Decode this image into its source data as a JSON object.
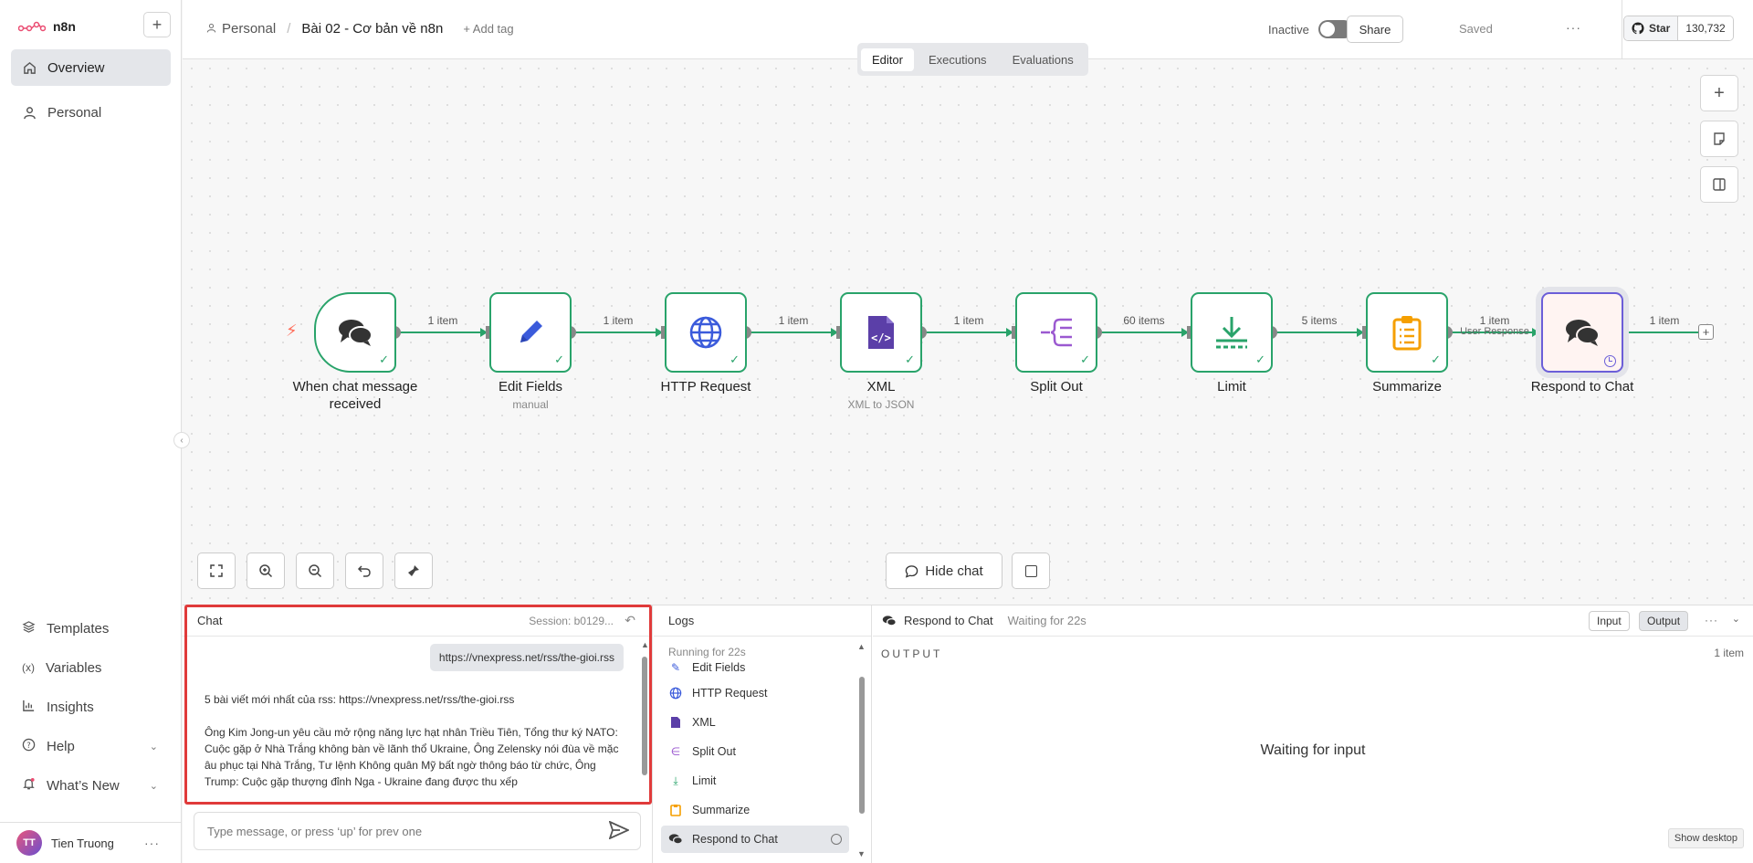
{
  "app": {
    "name": "n8n"
  },
  "sidebar": {
    "items": [
      {
        "label": "Overview",
        "icon": "home-icon"
      },
      {
        "label": "Personal",
        "icon": "user-icon"
      }
    ],
    "bottom": [
      {
        "label": "Templates",
        "icon": "layers-icon"
      },
      {
        "label": "Variables",
        "icon": "variable-icon"
      },
      {
        "label": "Insights",
        "icon": "chart-icon"
      },
      {
        "label": "Help",
        "icon": "help-icon"
      },
      {
        "label": "What’s New",
        "icon": "bell-icon"
      }
    ],
    "user": {
      "initials": "TT",
      "name": "Tien Truong"
    }
  },
  "header": {
    "breadcrumb_project": "Personal",
    "workflow_name": "Bài 02 - Cơ bản về n8n",
    "add_tag": "+ Add tag",
    "status": "Inactive",
    "share": "Share",
    "saved": "Saved",
    "github_star": "Star",
    "github_count": "130,732"
  },
  "tabs": [
    "Editor",
    "Executions",
    "Evaluations"
  ],
  "nodes": [
    {
      "name": "When chat message received",
      "line1": "When chat message",
      "line2": "received",
      "sub": "",
      "state": "success",
      "icon": "chat-icon"
    },
    {
      "name": "Edit Fields",
      "sub": "manual",
      "state": "success",
      "icon": "pencil-icon"
    },
    {
      "name": "HTTP Request",
      "sub": "",
      "state": "success",
      "icon": "globe-icon"
    },
    {
      "name": "XML",
      "sub": "XML to JSON",
      "state": "success",
      "icon": "xml-file-icon"
    },
    {
      "name": "Split Out",
      "sub": "",
      "state": "success",
      "icon": "split-icon"
    },
    {
      "name": "Limit",
      "sub": "",
      "state": "success",
      "icon": "limit-icon"
    },
    {
      "name": "Summarize",
      "sub": "",
      "state": "success",
      "icon": "clipboard-icon"
    },
    {
      "name": "Respond to Chat",
      "sub": "",
      "state": "waiting",
      "icon": "chat-icon"
    }
  ],
  "edges": [
    "1 item",
    "1 item",
    "1 item",
    "1 item",
    "60 items",
    "5 items",
    "1 item",
    "1 item"
  ],
  "edge_extra": "User Response",
  "canvas_controls": {
    "hide_chat": "Hide chat"
  },
  "chat": {
    "title": "Chat",
    "session": "Session: b0129...",
    "user_message": "https://vnexpress.net/rss/the-gioi.rss",
    "bot_line1": "5 bài viết mới nhất của rss: https://vnexpress.net/rss/the-gioi.rss",
    "bot_line2": "Ông Kim Jong-un yêu cầu mở rộng năng lực hạt nhân Triều Tiên, Tổng thư ký NATO: Cuộc gặp ở Nhà Trắng không bàn về lãnh thổ Ukraine, Ông Zelensky nói đùa về mặc âu phục tại Nhà Trắng, Tư lệnh Không quân Mỹ bất ngờ thông báo từ chức, Ông Trump: Cuộc gặp thượng đỉnh Nga - Ukraine đang được thu xếp",
    "input_placeholder": "Type message, or press ‘up’ for prev one"
  },
  "logs": {
    "title": "Logs",
    "running": "Running for 22s",
    "items": [
      {
        "label": "Edit Fields",
        "icon": "pencil-icon",
        "color": "#3b5bdb"
      },
      {
        "label": "HTTP Request",
        "icon": "globe-icon",
        "color": "#3b5bdb"
      },
      {
        "label": "XML",
        "icon": "xml-file-icon",
        "color": "#5b3fa8"
      },
      {
        "label": "Split Out",
        "icon": "split-icon",
        "color": "#9b59d0"
      },
      {
        "label": "Limit",
        "icon": "limit-icon",
        "color": "#29a36a"
      },
      {
        "label": "Summarize",
        "icon": "clipboard-icon",
        "color": "#f59f00"
      },
      {
        "label": "Respond to Chat",
        "icon": "chat-icon",
        "color": "#333333"
      }
    ]
  },
  "output": {
    "node": "Respond to Chat",
    "waiting": "Waiting for 22s",
    "input_btn": "Input",
    "output_btn": "Output",
    "label": "OUTPUT",
    "items": "1 item",
    "empty": "Waiting for input",
    "show_desktop": "Show desktop"
  },
  "colors": {
    "success": "#29a36a",
    "waiting": "#6b5ed8",
    "highlight": "#e03a3a",
    "brand": "#ff6d5a"
  }
}
